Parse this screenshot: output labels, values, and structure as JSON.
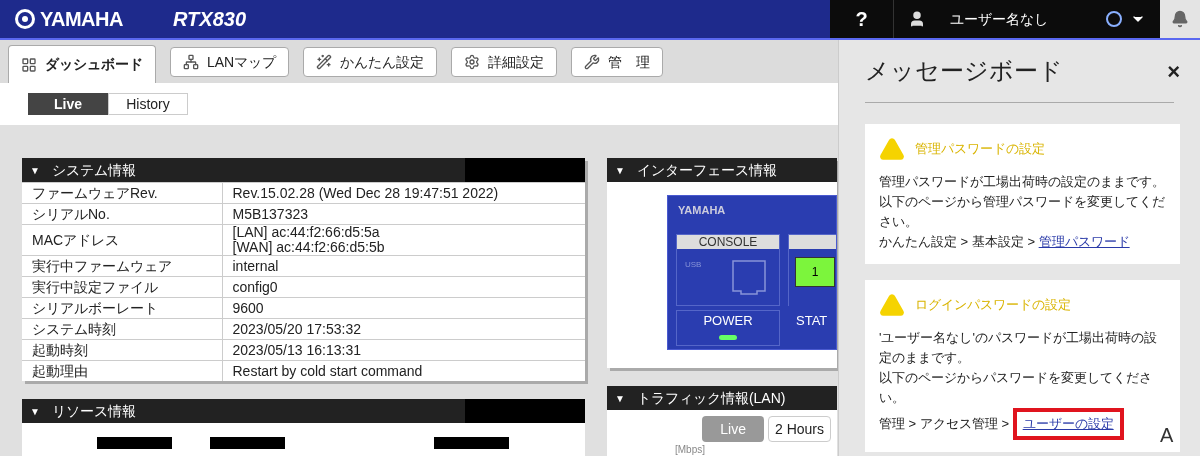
{
  "header": {
    "brand": "YAMAHA",
    "model": "RTX830",
    "help": "?",
    "user": "ユーザー名なし"
  },
  "nav_tabs": [
    {
      "label": "ダッシュボード",
      "selected": true
    },
    {
      "label": "LANマップ",
      "selected": false
    },
    {
      "label": "かんたん設定",
      "selected": false
    },
    {
      "label": "詳細設定",
      "selected": false
    },
    {
      "label": "管　理",
      "selected": false
    }
  ],
  "panel_toggle": "▼",
  "view_toggle": [
    {
      "label": "Live",
      "selected": true
    },
    {
      "label": "History",
      "selected": false
    }
  ],
  "system_info": {
    "title": "システム情報",
    "rows": [
      {
        "label": "ファームウェアRev.",
        "value": [
          "Rev.15.02.28 (Wed Dec 28 19:47:51 2022)"
        ]
      },
      {
        "label": "シリアルNo.",
        "value": [
          "M5B137323"
        ]
      },
      {
        "label": "MACアドレス",
        "value": [
          "[LAN] ac:44:f2:66:d5:5a",
          "[WAN] ac:44:f2:66:d5:5b"
        ]
      },
      {
        "label": "実行中ファームウェア",
        "value": [
          "internal"
        ]
      },
      {
        "label": "実行中設定ファイル",
        "value": [
          "config0"
        ]
      },
      {
        "label": "シリアルボーレート",
        "value": [
          "9600"
        ]
      },
      {
        "label": "システム時刻",
        "value": [
          "2023/05/20 17:53:32"
        ]
      },
      {
        "label": "起動時刻",
        "value": [
          "2023/05/13 16:13:31"
        ]
      },
      {
        "label": "起動理由",
        "value": [
          "Restart by cold start command"
        ]
      }
    ]
  },
  "resource_info": {
    "title": "リソース情報"
  },
  "interface_info": {
    "title": "インターフェース情報",
    "device": {
      "brand": "YAMAHA",
      "console": "CONSOLE",
      "usb": "USB",
      "port": "1",
      "port_on": true,
      "power": "POWER",
      "power_on": true,
      "status": "STAT"
    }
  },
  "traffic_info": {
    "title": "トラフィック情報(LAN)",
    "ranges": [
      {
        "label": "Live",
        "selected": true
      },
      {
        "label": "2 Hours",
        "selected": false
      }
    ],
    "unit": "[Mbps]"
  },
  "message_board": {
    "title": "メッセージボード",
    "close": "×",
    "messages": [
      {
        "title": "管理パスワードの設定",
        "lines": [
          "管理パスワードが工場出荷時の設定のままです。",
          "以下のページから管理パスワードを変更してください。"
        ],
        "path": "かんたん設定 > 基本設定 > ",
        "link": "管理パスワード",
        "highlighted": false
      },
      {
        "title": "ログインパスワードの設定",
        "lines": [
          "'ユーザー名なし'のパスワードが工場出荷時の設定のままです。",
          "以下のページからパスワードを変更してください。"
        ],
        "path": "管理 > アクセス管理 > ",
        "link": "ユーザーの設定",
        "highlighted": true
      }
    ]
  },
  "corner_letter": "A"
}
